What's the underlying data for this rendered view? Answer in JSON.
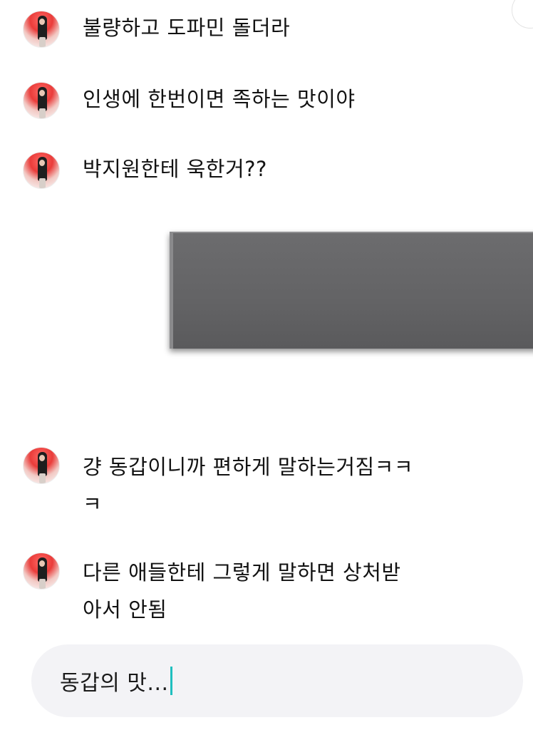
{
  "messages": [
    {
      "sender": "other",
      "text": "불량하고 도파민 돌더라"
    },
    {
      "sender": "other",
      "text": "인생에 한번이면 족하는 맛이야"
    },
    {
      "sender": "other",
      "text": "박지원한테 욱한거??"
    },
    {
      "sender": "other",
      "text": "걍 동갑이니까 편하게 말하는거짐ㅋㅋ\nㅋ"
    },
    {
      "sender": "other",
      "text": "다른 애들한테 그렇게 말하면 상처받\n아서 안됨"
    }
  ],
  "input": {
    "value": "동갑의 맛..."
  },
  "colors": {
    "background": "#ffffff",
    "input_background": "#f3f3f6",
    "cursor": "#1fbfbf",
    "redaction": "#636365"
  }
}
